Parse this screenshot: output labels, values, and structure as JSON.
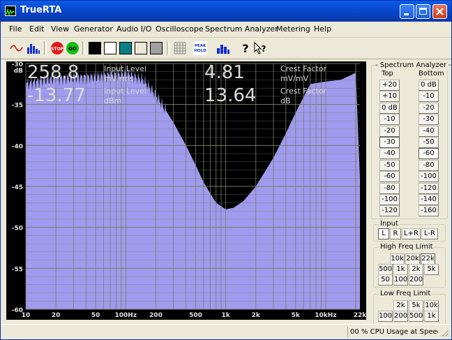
{
  "window": {
    "title": "TrueRTA"
  },
  "menu": [
    "File",
    "Edit",
    "View",
    "Generator",
    "Audio I/O",
    "Oscilloscope",
    "Spectrum Analyzer",
    "Metering",
    "Help"
  ],
  "toolbar": {
    "stop_label": "STOP",
    "go_label": "GO",
    "peak_hold_line1": "PEAK",
    "peak_hold_line2": "HOLD"
  },
  "readouts": {
    "input_level_value": "258.8",
    "input_level_label1": "Input Level",
    "input_level_label2": "mV rms",
    "input_dbm_value": "-13.77",
    "input_dbm_label1": "Input Level",
    "input_dbm_label2": "dBm",
    "crest_value": "4.81",
    "crest_label1": "Crest Factor",
    "crest_label2": "mV/mV",
    "crest_db_value": "13.64",
    "crest_db_label1": "Crest Factor",
    "crest_db_label2": "dB"
  },
  "chart_data": {
    "type": "area",
    "y_axis": {
      "unit_label": "dB",
      "ticks": [
        "-30",
        "-35",
        "-40",
        "-45",
        "-50",
        "-55",
        "-60"
      ],
      "ylim": [
        -60,
        -30
      ]
    },
    "x_axis": {
      "scale": "log",
      "ticks": [
        "10",
        "20",
        "50",
        "100Hz",
        "200",
        "500",
        "1k",
        "2k",
        "5k",
        "10kHz",
        "22k"
      ],
      "xlim": [
        10,
        22000
      ]
    },
    "series": [
      {
        "x": [
          10,
          15,
          20,
          30,
          50,
          70,
          100,
          150,
          200,
          300,
          400,
          500,
          600,
          800,
          1000,
          1200,
          1500,
          2000,
          3000,
          4000,
          5000,
          7000,
          10000,
          14000,
          18000,
          20000,
          22000
        ],
        "y": [
          -32.5,
          -32.0,
          -31.8,
          -31.7,
          -31.6,
          -31.4,
          -31.2,
          -32.0,
          -33.8,
          -37.2,
          -40.0,
          -42.4,
          -44.5,
          -47.0,
          -47.8,
          -47.6,
          -46.8,
          -45.0,
          -41.5,
          -38.5,
          -36.0,
          -32.5,
          -32.2,
          -32.0,
          -31.4,
          -31.1,
          -44.0
        ]
      }
    ],
    "colors": {
      "fill": "#a09bee",
      "background": "#000000",
      "grid": "#7a7a66"
    },
    "grid": true
  },
  "panel": {
    "title": "Spectrum Analyzer",
    "top_label": "Top",
    "bottom_label": "Bottom",
    "top_values": [
      "+20",
      "+10",
      "0 dB",
      "-10",
      "-20",
      "-30",
      "-40",
      "-50",
      "-60",
      "-80",
      "-100",
      "-120"
    ],
    "top_selected": "-30",
    "bottom_values": [
      "0 dB",
      "-10",
      "-20",
      "-30",
      "-40",
      "-50",
      "-60",
      "-80",
      "-100",
      "-120",
      "-140",
      "-160"
    ],
    "bottom_selected": "-60",
    "input_label": "Input",
    "input_values": [
      "L",
      "R",
      "L+R",
      "L-R"
    ],
    "input_selected": "L",
    "hf_label": "High Freq Limit",
    "hf_values": [
      "10k",
      "20k",
      "22k",
      "500",
      "1k",
      "2k",
      "5k",
      "50",
      "100",
      "200"
    ],
    "hf_selected": "22k",
    "lf_label": "Low Freq Limit",
    "lf_values": [
      "2k",
      "5k",
      "10k",
      "100",
      "200",
      "500",
      "1k"
    ]
  },
  "status": {
    "cpu_text": "00 % CPU Usage at Speec"
  }
}
